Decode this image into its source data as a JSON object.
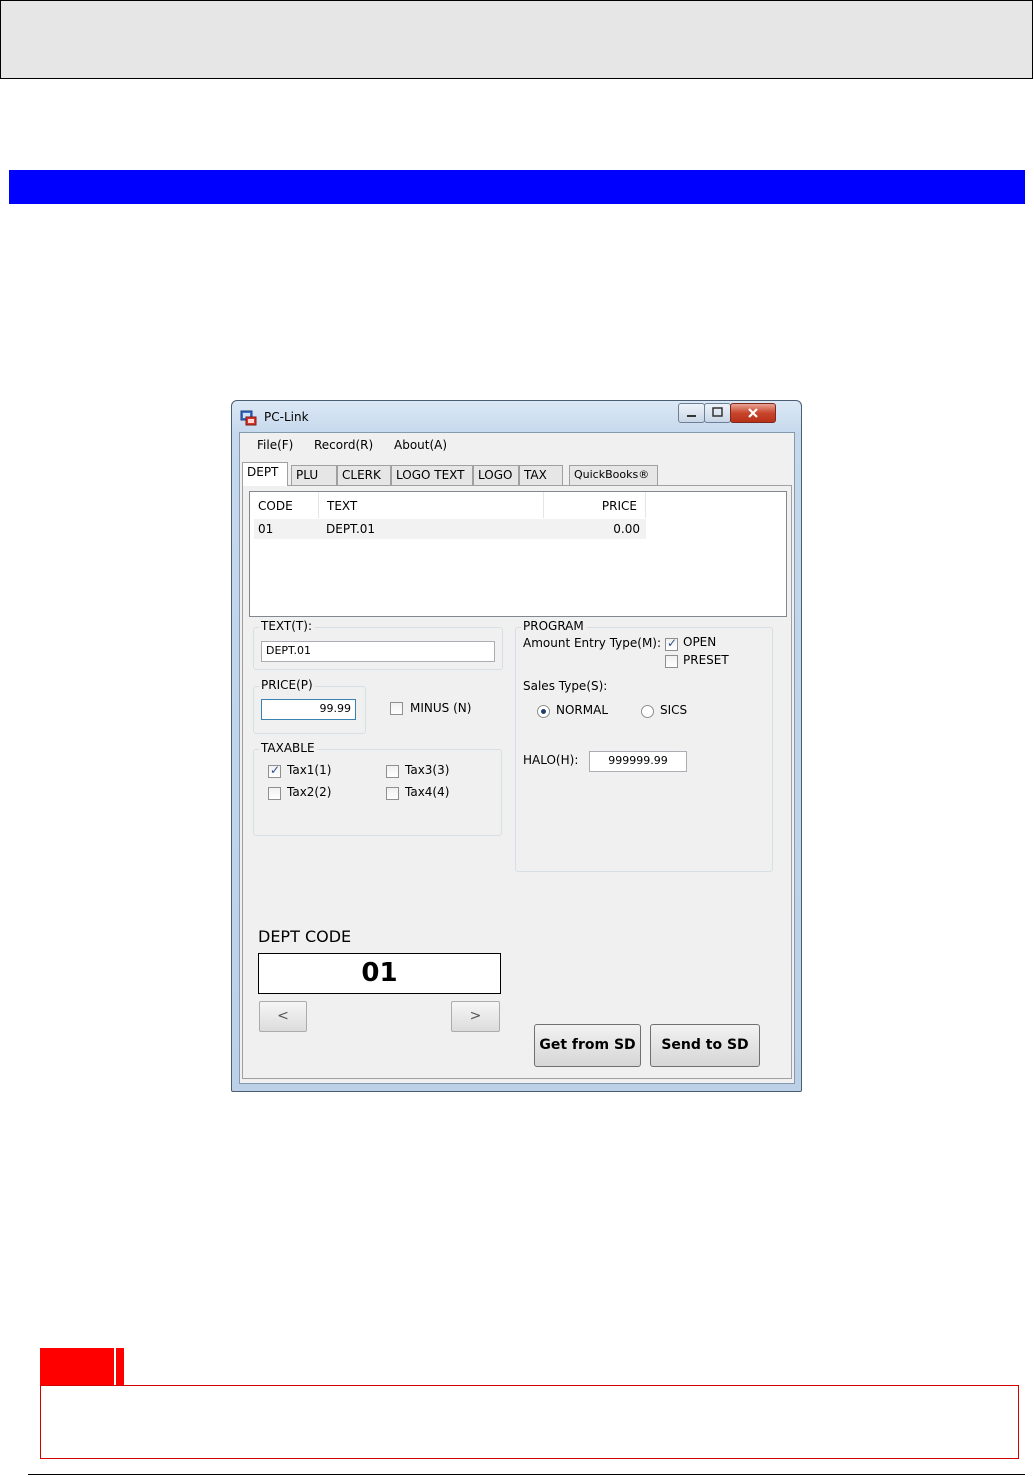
{
  "window": {
    "title": "PC-Link"
  },
  "menu": [
    "File(F)",
    "Record(R)",
    "About(A)"
  ],
  "tabs": [
    "DEPT",
    "PLU",
    "CLERK",
    "LOGO TEXT",
    "LOGO",
    "TAX",
    "QuickBooks®"
  ],
  "list": {
    "columns": [
      "CODE",
      "TEXT",
      "PRICE"
    ],
    "rows": [
      {
        "code": "01",
        "text": "DEPT.01",
        "price": "0.00"
      }
    ]
  },
  "form": {
    "text_label": "TEXT(T):",
    "text_value": "DEPT.01",
    "price_label": "PRICE(P)",
    "price_value": "99.99",
    "minus_label": "MINUS (N)",
    "taxable_label": "TAXABLE",
    "tax": [
      {
        "label": "Tax1(1)",
        "checked": true
      },
      {
        "label": "Tax2(2)",
        "checked": false
      },
      {
        "label": "Tax3(3)",
        "checked": false
      },
      {
        "label": "Tax4(4)",
        "checked": false
      }
    ]
  },
  "program": {
    "label": "PROGRAM",
    "amount_entry_label": "Amount Entry Type(M):",
    "open_label": "OPEN",
    "preset_label": "PRESET",
    "sales_type_label": "Sales Type(S):",
    "normal_label": "NORMAL",
    "sics_label": "SICS",
    "halo_label": "HALO(H):",
    "halo_value": "999999.99"
  },
  "dept_code": {
    "title": "DEPT CODE",
    "value": "01",
    "prev": "<",
    "next": ">"
  },
  "buttons": {
    "get": "Get from SD",
    "send": "Send to SD"
  }
}
